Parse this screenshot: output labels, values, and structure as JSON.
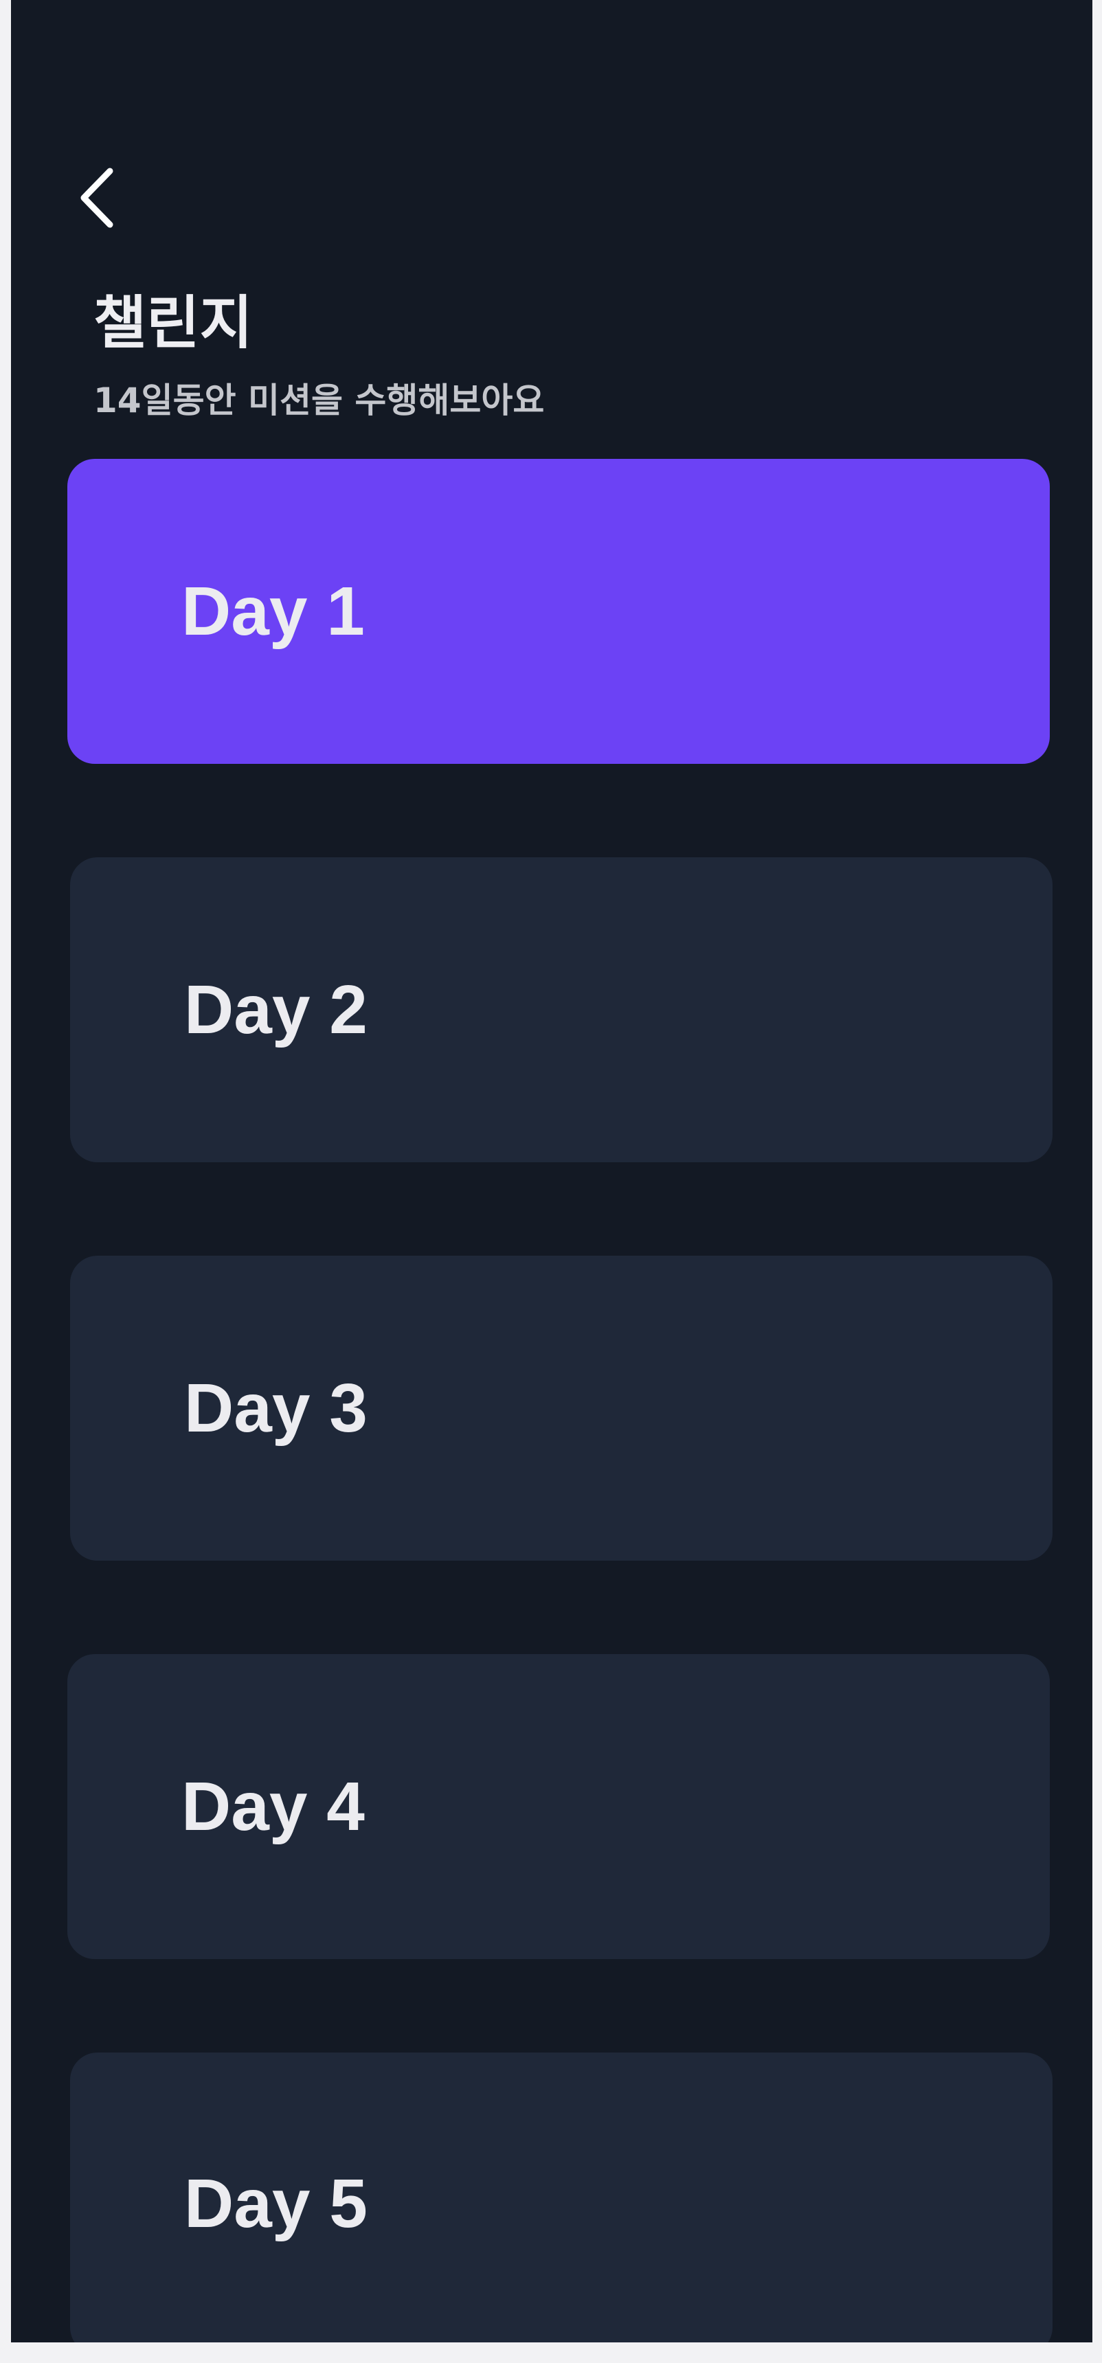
{
  "header": {
    "back_icon": "chevron-left-icon",
    "title": "챌린지",
    "subtitle": "14일동안 미션을 수행해보아요"
  },
  "days": [
    {
      "label": "Day 1",
      "active": true
    },
    {
      "label": "Day 2",
      "active": false
    },
    {
      "label": "Day 3",
      "active": false
    },
    {
      "label": "Day 4",
      "active": false
    },
    {
      "label": "Day 5",
      "active": false
    }
  ],
  "colors": {
    "background": "#131924",
    "card": "#1f2839",
    "active_card": "#6c42f5",
    "text": "#ececf0",
    "subtext": "#c4c6cc"
  }
}
